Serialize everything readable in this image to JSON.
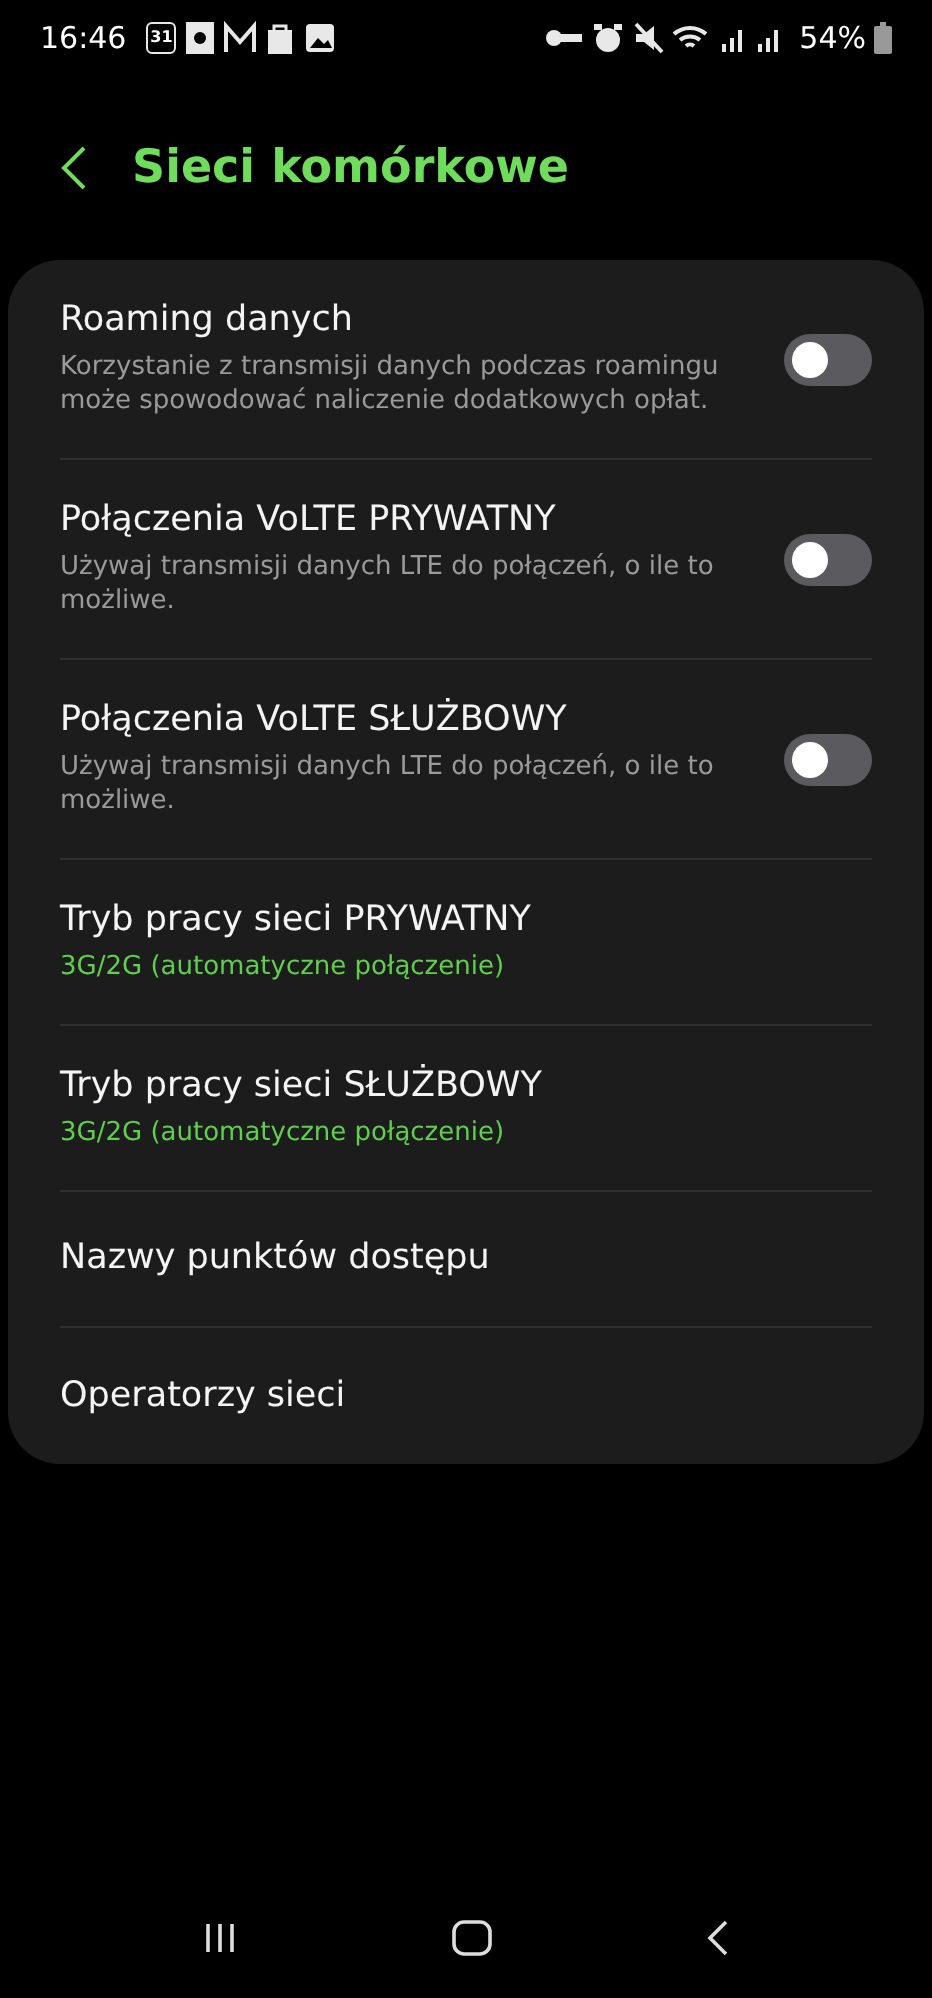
{
  "status_bar": {
    "time": "16:46",
    "calendar_day": "31",
    "battery": "54%"
  },
  "header": {
    "title": "Sieci komórkowe"
  },
  "items": [
    {
      "kind": "toggle",
      "title": "Roaming danych",
      "summary": "Korzystanie z transmisji danych podczas roamingu może spowodować naliczenie dodatkowych opłat.",
      "on": false
    },
    {
      "kind": "toggle",
      "title": "Połączenia VoLTE PRYWATNY",
      "summary": "Używaj transmisji danych LTE do połączeń, o ile to możliwe.",
      "on": false
    },
    {
      "kind": "toggle",
      "title": "Połączenia VoLTE SŁUŻBOWY",
      "summary": "Używaj transmisji danych LTE do połączeń, o ile to możliwe.",
      "on": false
    },
    {
      "kind": "value",
      "title": "Tryb pracy sieci PRYWATNY",
      "summary": "3G/2G (automatyczne połączenie)"
    },
    {
      "kind": "value",
      "title": "Tryb pracy sieci SŁUŻBOWY",
      "summary": "3G/2G (automatyczne połączenie)"
    },
    {
      "kind": "link",
      "title": "Nazwy punktów dostępu"
    },
    {
      "kind": "link",
      "title": "Operatorzy sieci"
    }
  ]
}
